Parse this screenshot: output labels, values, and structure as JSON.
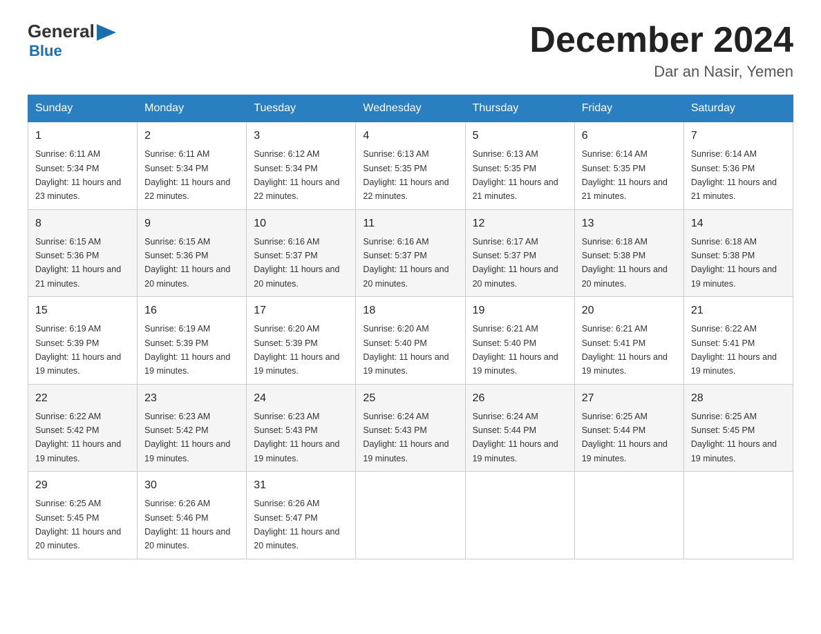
{
  "logo": {
    "general": "General",
    "blue": "Blue"
  },
  "title": "December 2024",
  "location": "Dar an Nasir, Yemen",
  "days_of_week": [
    "Sunday",
    "Monday",
    "Tuesday",
    "Wednesday",
    "Thursday",
    "Friday",
    "Saturday"
  ],
  "weeks": [
    [
      {
        "day": "1",
        "sunrise": "6:11 AM",
        "sunset": "5:34 PM",
        "daylight": "11 hours and 23 minutes."
      },
      {
        "day": "2",
        "sunrise": "6:11 AM",
        "sunset": "5:34 PM",
        "daylight": "11 hours and 22 minutes."
      },
      {
        "day": "3",
        "sunrise": "6:12 AM",
        "sunset": "5:34 PM",
        "daylight": "11 hours and 22 minutes."
      },
      {
        "day": "4",
        "sunrise": "6:13 AM",
        "sunset": "5:35 PM",
        "daylight": "11 hours and 22 minutes."
      },
      {
        "day": "5",
        "sunrise": "6:13 AM",
        "sunset": "5:35 PM",
        "daylight": "11 hours and 21 minutes."
      },
      {
        "day": "6",
        "sunrise": "6:14 AM",
        "sunset": "5:35 PM",
        "daylight": "11 hours and 21 minutes."
      },
      {
        "day": "7",
        "sunrise": "6:14 AM",
        "sunset": "5:36 PM",
        "daylight": "11 hours and 21 minutes."
      }
    ],
    [
      {
        "day": "8",
        "sunrise": "6:15 AM",
        "sunset": "5:36 PM",
        "daylight": "11 hours and 21 minutes."
      },
      {
        "day": "9",
        "sunrise": "6:15 AM",
        "sunset": "5:36 PM",
        "daylight": "11 hours and 20 minutes."
      },
      {
        "day": "10",
        "sunrise": "6:16 AM",
        "sunset": "5:37 PM",
        "daylight": "11 hours and 20 minutes."
      },
      {
        "day": "11",
        "sunrise": "6:16 AM",
        "sunset": "5:37 PM",
        "daylight": "11 hours and 20 minutes."
      },
      {
        "day": "12",
        "sunrise": "6:17 AM",
        "sunset": "5:37 PM",
        "daylight": "11 hours and 20 minutes."
      },
      {
        "day": "13",
        "sunrise": "6:18 AM",
        "sunset": "5:38 PM",
        "daylight": "11 hours and 20 minutes."
      },
      {
        "day": "14",
        "sunrise": "6:18 AM",
        "sunset": "5:38 PM",
        "daylight": "11 hours and 19 minutes."
      }
    ],
    [
      {
        "day": "15",
        "sunrise": "6:19 AM",
        "sunset": "5:39 PM",
        "daylight": "11 hours and 19 minutes."
      },
      {
        "day": "16",
        "sunrise": "6:19 AM",
        "sunset": "5:39 PM",
        "daylight": "11 hours and 19 minutes."
      },
      {
        "day": "17",
        "sunrise": "6:20 AM",
        "sunset": "5:39 PM",
        "daylight": "11 hours and 19 minutes."
      },
      {
        "day": "18",
        "sunrise": "6:20 AM",
        "sunset": "5:40 PM",
        "daylight": "11 hours and 19 minutes."
      },
      {
        "day": "19",
        "sunrise": "6:21 AM",
        "sunset": "5:40 PM",
        "daylight": "11 hours and 19 minutes."
      },
      {
        "day": "20",
        "sunrise": "6:21 AM",
        "sunset": "5:41 PM",
        "daylight": "11 hours and 19 minutes."
      },
      {
        "day": "21",
        "sunrise": "6:22 AM",
        "sunset": "5:41 PM",
        "daylight": "11 hours and 19 minutes."
      }
    ],
    [
      {
        "day": "22",
        "sunrise": "6:22 AM",
        "sunset": "5:42 PM",
        "daylight": "11 hours and 19 minutes."
      },
      {
        "day": "23",
        "sunrise": "6:23 AM",
        "sunset": "5:42 PM",
        "daylight": "11 hours and 19 minutes."
      },
      {
        "day": "24",
        "sunrise": "6:23 AM",
        "sunset": "5:43 PM",
        "daylight": "11 hours and 19 minutes."
      },
      {
        "day": "25",
        "sunrise": "6:24 AM",
        "sunset": "5:43 PM",
        "daylight": "11 hours and 19 minutes."
      },
      {
        "day": "26",
        "sunrise": "6:24 AM",
        "sunset": "5:44 PM",
        "daylight": "11 hours and 19 minutes."
      },
      {
        "day": "27",
        "sunrise": "6:25 AM",
        "sunset": "5:44 PM",
        "daylight": "11 hours and 19 minutes."
      },
      {
        "day": "28",
        "sunrise": "6:25 AM",
        "sunset": "5:45 PM",
        "daylight": "11 hours and 19 minutes."
      }
    ],
    [
      {
        "day": "29",
        "sunrise": "6:25 AM",
        "sunset": "5:45 PM",
        "daylight": "11 hours and 20 minutes."
      },
      {
        "day": "30",
        "sunrise": "6:26 AM",
        "sunset": "5:46 PM",
        "daylight": "11 hours and 20 minutes."
      },
      {
        "day": "31",
        "sunrise": "6:26 AM",
        "sunset": "5:47 PM",
        "daylight": "11 hours and 20 minutes."
      },
      null,
      null,
      null,
      null
    ]
  ]
}
